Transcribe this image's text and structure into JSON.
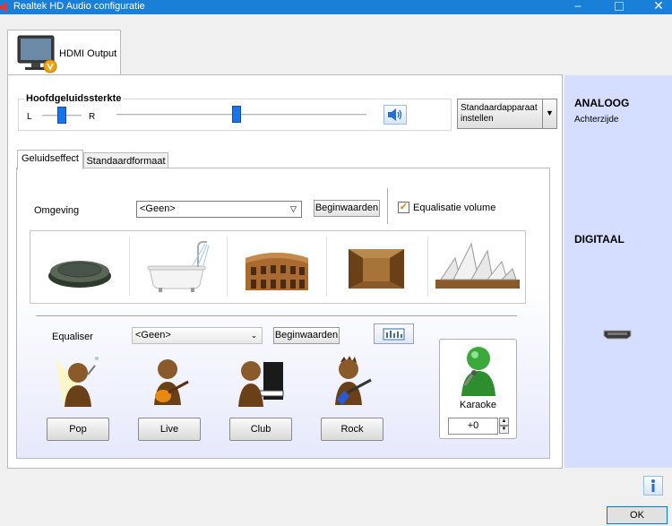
{
  "window": {
    "title": "Realtek HD Audio configuratie"
  },
  "device_tab": {
    "label": "HDMI Output",
    "icon": "monitor-icon"
  },
  "volume": {
    "title": "Hoofdgeluidssterkte",
    "left": "L",
    "right": "R",
    "balance": 0.5,
    "level": 0.48,
    "set_default_label": "Standaardapparaat instellen"
  },
  "tabs": [
    {
      "label": "Geluidseffect",
      "active": true
    },
    {
      "label": "Standaardformaat",
      "active": false
    }
  ],
  "environment": {
    "label": "Omgeving",
    "selected": "<Geen>",
    "reset_label": "Beginwaarden",
    "eq_volume_label": "Equalisatie volume",
    "eq_volume_checked": true,
    "presets": [
      "stone-icon",
      "bathtub-icon",
      "colosseum-icon",
      "stone-room-icon",
      "opera-house-icon"
    ]
  },
  "equalizer": {
    "label": "Equaliser",
    "selected": "<Geen>",
    "reset_label": "Beginwaarden",
    "presets": [
      "Pop",
      "Live",
      "Club",
      "Rock"
    ]
  },
  "karaoke": {
    "label": "Karaoke",
    "value": "+0"
  },
  "side_panel": {
    "analog_title": "ANALOOG",
    "analog_sub": "Achterzijde",
    "digital_title": "DIGITAAL",
    "digital_icon": "hdmi-port-icon"
  },
  "footer": {
    "ok_label": "OK"
  },
  "colors": {
    "titlebar": "#1a7fd6",
    "side_panel": "#d6deff",
    "accent": "#1a73e8"
  }
}
